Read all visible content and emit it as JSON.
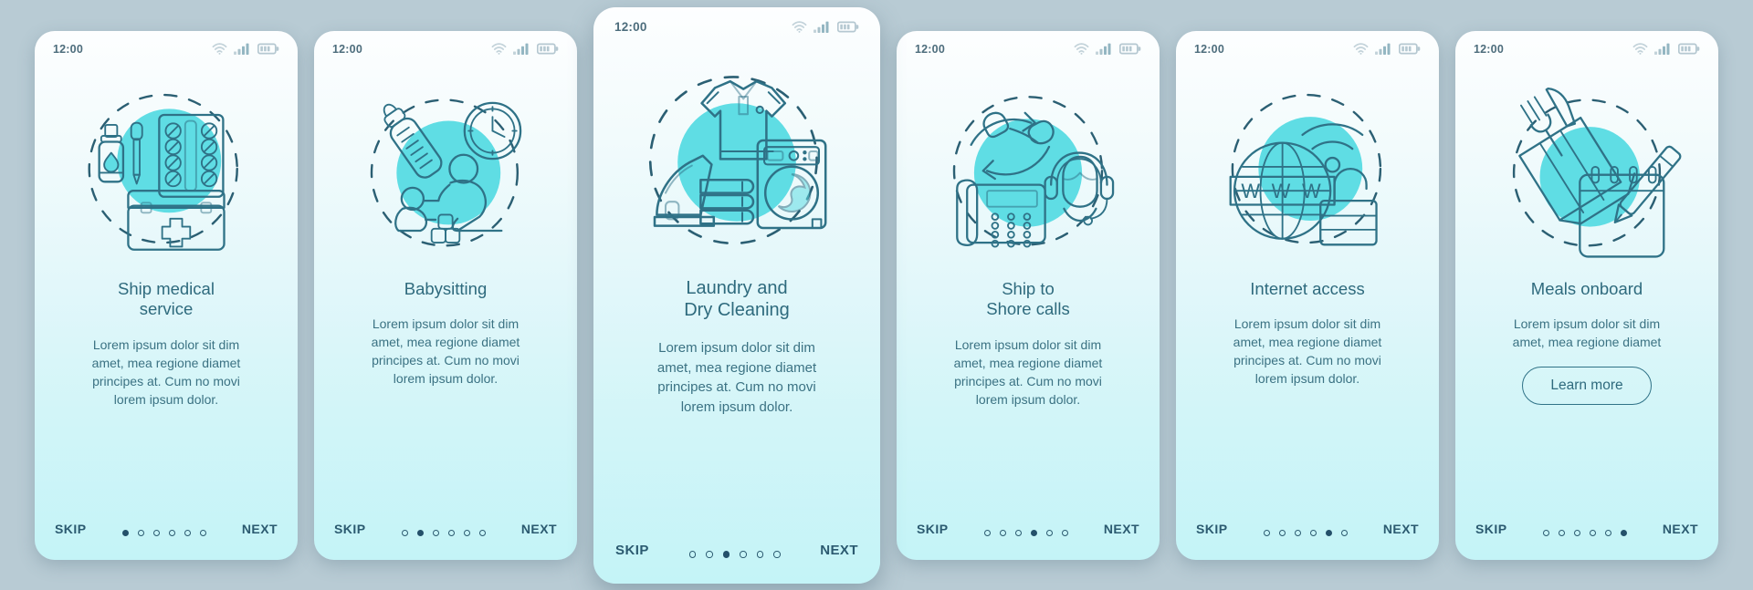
{
  "theme": {
    "page_background": "#b8cbd4",
    "card_gradient_top": "#fdfeff",
    "card_gradient_bottom": "#c4f4f7",
    "accent_cyan": "#5fdde4",
    "line_teal": "#2f7287",
    "title_color": "#2e6a7d",
    "body_color": "#3b7283",
    "nav_color": "#2b5a70",
    "dot_active_color": "#24506a"
  },
  "status_bar": {
    "time": "12:00",
    "icons": [
      "wifi-icon",
      "cellular-signal-icon",
      "battery-icon"
    ]
  },
  "nav": {
    "skip_label": "SKIP",
    "next_label": "NEXT",
    "total_dots": 6
  },
  "shared": {
    "body_four_line": "Lorem ipsum dolor sit dim\namet, mea regione diamet\nprincipes at. Cum no movi\nlorem ipsum dolor.",
    "body_two_line": "Lorem ipsum dolor sit dim\namet, mea regione diamet"
  },
  "screens": [
    {
      "id": "ship-medical-service",
      "title": "Ship medical\nservice",
      "body": "Lorem ipsum dolor sit dim\namet, mea regione diamet\nprincipes at. Cum no movi\nlorem ipsum dolor.",
      "time": "12:00",
      "skip_label": "SKIP",
      "next_label": "NEXT",
      "active_dot": 1,
      "illustration": "medical-kit-illustration",
      "has_cta": false,
      "featured": false
    },
    {
      "id": "babysitting",
      "title": "Babysitting",
      "body": "Lorem ipsum dolor sit dim\namet, mea regione diamet\nprincipes at. Cum no movi\nlorem ipsum dolor.",
      "time": "12:00",
      "skip_label": "SKIP",
      "next_label": "NEXT",
      "active_dot": 2,
      "illustration": "babysitting-illustration",
      "has_cta": false,
      "featured": false
    },
    {
      "id": "laundry-and-dry-cleaning",
      "title": "Laundry and\nDry Cleaning",
      "body": "Lorem ipsum dolor sit dim\namet, mea regione diamet\nprincipes at. Cum no movi\nlorem ipsum dolor.",
      "time": "12:00",
      "skip_label": "SKIP",
      "next_label": "NEXT",
      "active_dot": 3,
      "illustration": "laundry-illustration",
      "has_cta": false,
      "featured": true
    },
    {
      "id": "ship-to-shore-calls",
      "title": "Ship to\nShore calls",
      "body": "Lorem ipsum dolor sit dim\namet, mea regione diamet\nprincipes at. Cum no movi\nlorem ipsum dolor.",
      "time": "12:00",
      "skip_label": "SKIP",
      "next_label": "NEXT",
      "active_dot": 4,
      "illustration": "shore-calls-illustration",
      "has_cta": false,
      "featured": false
    },
    {
      "id": "internet-access",
      "title": "Internet access",
      "body": "Lorem ipsum dolor sit dim\namet, mea regione diamet\nprincipes at. Cum no movi\nlorem ipsum dolor.",
      "time": "12:00",
      "skip_label": "SKIP",
      "next_label": "NEXT",
      "active_dot": 5,
      "illustration": "internet-access-illustration",
      "has_cta": false,
      "featured": false
    },
    {
      "id": "meals-onboard",
      "title": "Meals onboard",
      "body": "Lorem ipsum dolor sit dim\namet, mea regione diamet",
      "time": "12:00",
      "skip_label": "SKIP",
      "next_label": "NEXT",
      "active_dot": 6,
      "illustration": "meals-onboard-illustration",
      "has_cta": true,
      "cta_label": "Learn more",
      "featured": false
    }
  ]
}
